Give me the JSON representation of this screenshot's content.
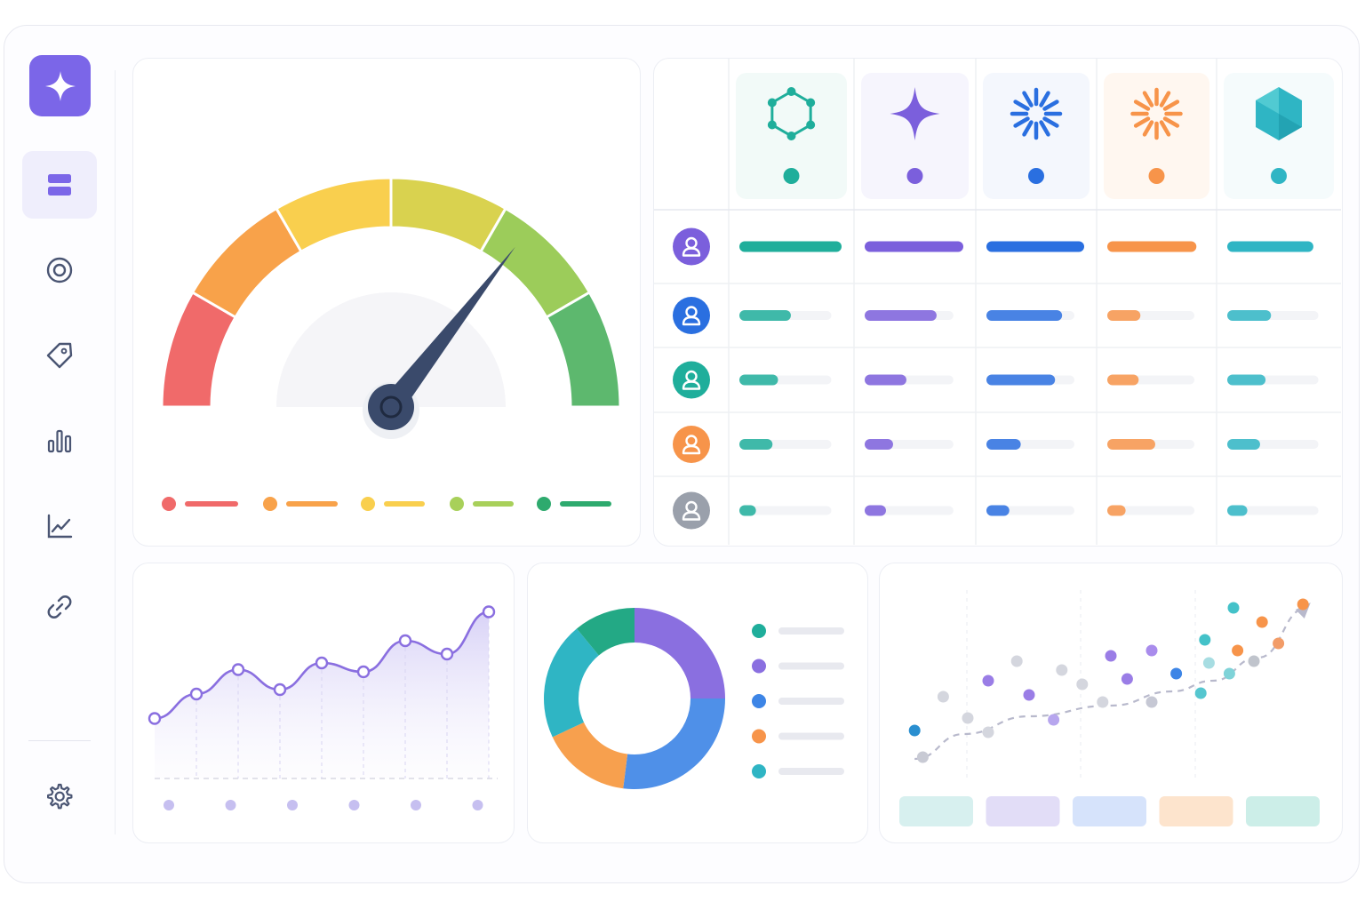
{
  "sidebar": {
    "logo_icon": "sparkle-icon",
    "items": [
      {
        "icon": "layers-icon",
        "active": true
      },
      {
        "icon": "target-icon",
        "active": false
      },
      {
        "icon": "tag-icon",
        "active": false
      },
      {
        "icon": "bar-chart-icon",
        "active": false
      },
      {
        "icon": "line-chart-icon",
        "active": false
      },
      {
        "icon": "link-icon",
        "active": false
      }
    ],
    "footer_icon": "gear-icon"
  },
  "colors": {
    "accent": "#7b66e8",
    "teal": "#1fae9b",
    "purple": "#7b5fdc",
    "blue": "#2a6fe0",
    "orange": "#f7944a",
    "cyan": "#4fc4cf",
    "red": "#f06a6a",
    "yellow": "#f9cf4e",
    "lime": "#a8d05a",
    "green": "#3fae6b",
    "navy": "#3a4a6b"
  },
  "gauge": {
    "needle_value": 0.71,
    "segments": [
      "#f06a6a",
      "#f8a24a",
      "#f9cf4e",
      "#d9d24f",
      "#9ccc5a",
      "#5db86e"
    ],
    "legend": [
      {
        "dot": "#f06a6a"
      },
      {
        "dot": "#f8a24a"
      },
      {
        "dot": "#f9cf4e"
      },
      {
        "dot": "#a8d05a"
      },
      {
        "dot": "#2eaa6e"
      }
    ]
  },
  "matrix": {
    "columns": [
      {
        "icon": "hexagon-network-icon",
        "color": "#1fae9b",
        "bg": "#f2faf8"
      },
      {
        "icon": "four-point-star-icon",
        "color": "#7b5fdc",
        "bg": "#f6f5fd"
      },
      {
        "icon": "burst-icon",
        "color": "#2a6fe0",
        "bg": "#f4f7fd"
      },
      {
        "icon": "sun-burst-icon",
        "color": "#f7944a",
        "bg": "#fff7f0"
      },
      {
        "icon": "cube-icon",
        "color": "#2fb5c4",
        "bg": "#f5fbfc"
      }
    ],
    "rows": [
      {
        "avatar_color": "#7b5fdc",
        "values": [
          1.0,
          1.0,
          1.0,
          0.92,
          0.85
        ]
      },
      {
        "avatar_color": "#2a6fe0",
        "values": [
          0.56,
          0.81,
          0.86,
          0.38,
          0.48
        ]
      },
      {
        "avatar_color": "#1fae9b",
        "values": [
          0.42,
          0.47,
          0.78,
          0.36,
          0.42
        ]
      },
      {
        "avatar_color": "#f7944a",
        "values": [
          0.36,
          0.32,
          0.39,
          0.55,
          0.36
        ]
      },
      {
        "avatar_color": "#9aa0ab",
        "values": [
          0.18,
          0.24,
          0.26,
          0.21,
          0.22
        ]
      }
    ]
  },
  "line_chart": {
    "type": "line",
    "values": [
      0.27,
      0.38,
      0.49,
      0.4,
      0.52,
      0.48,
      0.62,
      0.56,
      0.75
    ],
    "line_color": "#8a6fe0",
    "x_dot_count": 6
  },
  "donut": {
    "type": "pie",
    "slices": [
      {
        "value": 0.25,
        "color": "#8a6fe0"
      },
      {
        "value": 0.27,
        "color": "#4f90e8"
      },
      {
        "value": 0.16,
        "color": "#f7a04e"
      },
      {
        "value": 0.21,
        "color": "#2fb5c4"
      },
      {
        "value": 0.11,
        "color": "#23a985"
      }
    ],
    "legend": [
      {
        "dot": "#1fae9b"
      },
      {
        "dot": "#8a6fe0"
      },
      {
        "dot": "#3d85e6"
      },
      {
        "dot": "#f7944a"
      },
      {
        "dot": "#2fb5c4"
      }
    ]
  },
  "scatter": {
    "type": "scatter",
    "trend": [
      [
        0.02,
        0.08
      ],
      [
        0.14,
        0.22
      ],
      [
        0.3,
        0.32
      ],
      [
        0.5,
        0.38
      ],
      [
        0.65,
        0.46
      ],
      [
        0.75,
        0.52
      ],
      [
        0.86,
        0.65
      ],
      [
        0.98,
        0.93
      ]
    ],
    "points": [
      {
        "x": 0.02,
        "y": 0.24,
        "c": "#2a8fd0"
      },
      {
        "x": 0.04,
        "y": 0.09,
        "c": "#c8cad4"
      },
      {
        "x": 0.09,
        "y": 0.43,
        "c": "#d4d6de"
      },
      {
        "x": 0.15,
        "y": 0.31,
        "c": "#d4d6de"
      },
      {
        "x": 0.2,
        "y": 0.23,
        "c": "#d4d6de"
      },
      {
        "x": 0.2,
        "y": 0.52,
        "c": "#9a7de6"
      },
      {
        "x": 0.27,
        "y": 0.63,
        "c": "#d4d6de"
      },
      {
        "x": 0.3,
        "y": 0.44,
        "c": "#9a7de6"
      },
      {
        "x": 0.36,
        "y": 0.3,
        "c": "#b7a6ee"
      },
      {
        "x": 0.38,
        "y": 0.58,
        "c": "#d4d6de"
      },
      {
        "x": 0.43,
        "y": 0.5,
        "c": "#d4d6de"
      },
      {
        "x": 0.48,
        "y": 0.4,
        "c": "#d4d6de"
      },
      {
        "x": 0.5,
        "y": 0.66,
        "c": "#9a7de6"
      },
      {
        "x": 0.54,
        "y": 0.53,
        "c": "#9a7de6"
      },
      {
        "x": 0.6,
        "y": 0.69,
        "c": "#a98cec"
      },
      {
        "x": 0.6,
        "y": 0.4,
        "c": "#c6c8d4"
      },
      {
        "x": 0.66,
        "y": 0.56,
        "c": "#3d85e6"
      },
      {
        "x": 0.72,
        "y": 0.45,
        "c": "#55c6cf"
      },
      {
        "x": 0.73,
        "y": 0.75,
        "c": "#44c2c9"
      },
      {
        "x": 0.74,
        "y": 0.62,
        "c": "#a7dde2"
      },
      {
        "x": 0.8,
        "y": 0.93,
        "c": "#44c2c9"
      },
      {
        "x": 0.79,
        "y": 0.56,
        "c": "#7fd3d8"
      },
      {
        "x": 0.81,
        "y": 0.69,
        "c": "#f7944a"
      },
      {
        "x": 0.85,
        "y": 0.63,
        "c": "#c0c4cc"
      },
      {
        "x": 0.87,
        "y": 0.85,
        "c": "#f7944a"
      },
      {
        "x": 0.91,
        "y": 0.73,
        "c": "#f29c68"
      },
      {
        "x": 0.97,
        "y": 0.95,
        "c": "#f7944a"
      }
    ],
    "legend_colors": [
      "#d7f0ef",
      "#e2ddf7",
      "#d6e3fb",
      "#fde4cd",
      "#cceee8"
    ]
  }
}
